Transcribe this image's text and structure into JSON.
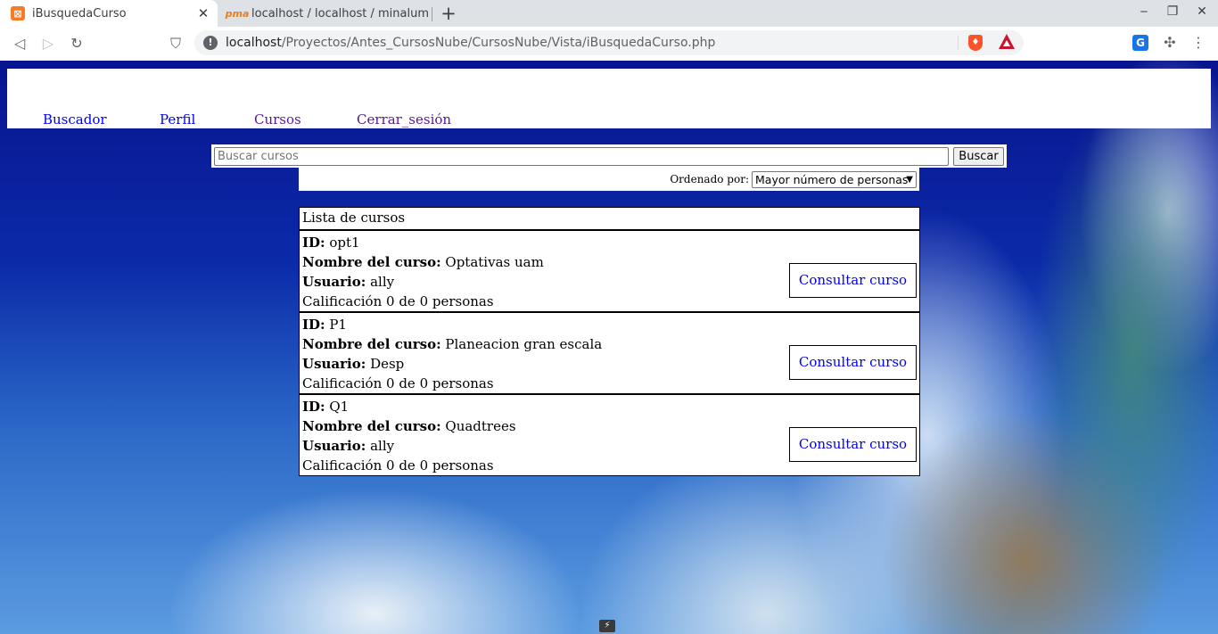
{
  "browser": {
    "tabs": [
      {
        "title": "iBusquedaCurso",
        "active": true,
        "favicon": "xampp-icon"
      },
      {
        "title": "localhost / localhost / minalum",
        "active": false,
        "favicon": "phpmyadmin-icon"
      }
    ],
    "url": {
      "host": "localhost",
      "path": "/Proyectos/Antes_CursosNube/CursosNube/Vista/iBusquedaCurso.php"
    }
  },
  "nav": {
    "links": [
      "Buscador",
      "Perfil",
      "Cursos",
      "Cerrar_sesión"
    ]
  },
  "search": {
    "placeholder": "Buscar cursos",
    "value": "",
    "button_label": "Buscar"
  },
  "sort": {
    "label": "Ordenado por:",
    "selected": "Mayor número de personas"
  },
  "results": {
    "heading": "Lista de cursos",
    "id_label": "ID:",
    "name_label": "Nombre del curso:",
    "user_label": "Usuario:",
    "consult_label": "Consultar curso",
    "courses": [
      {
        "id": "opt1",
        "name": "Optativas uam",
        "user": "ally",
        "rating": "Calificación 0 de 0 personas"
      },
      {
        "id": "P1",
        "name": "Planeacion gran escala",
        "user": "Desp",
        "rating": "Calificación 0 de 0 personas"
      },
      {
        "id": "Q1",
        "name": "Quadtrees",
        "user": "ally",
        "rating": "Calificación 0 de 0 personas"
      }
    ]
  },
  "colors": {
    "link": "#0000ee",
    "visited_link": "#551a8b",
    "background_sky": "#08148f"
  }
}
